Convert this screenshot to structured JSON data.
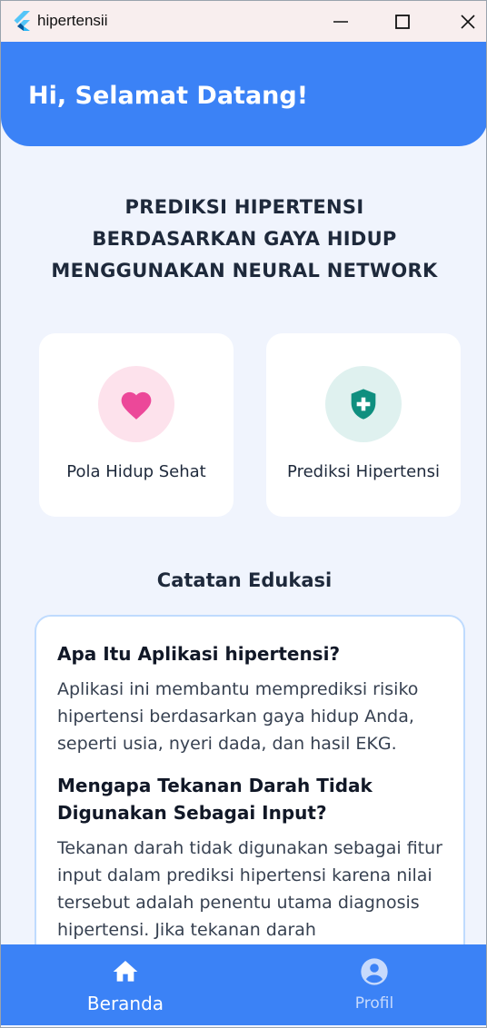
{
  "window": {
    "title": "hipertensii"
  },
  "header": {
    "greeting": "Hi, Selamat Datang!"
  },
  "main": {
    "title_lines": [
      "PREDIKSI HIPERTENSI",
      "BERDASARKAN GAYA HIDUP",
      "MENGGUNAKAN NEURAL NETWORK"
    ],
    "cards": [
      {
        "label": "Pola Hidup Sehat",
        "icon": "heart-icon",
        "icon_color": "#ec4899",
        "circle_color": "#fde2ec"
      },
      {
        "label": "Prediksi Hipertensi",
        "icon": "shield-plus-icon",
        "icon_color": "#0f8f7f",
        "circle_color": "#dff1ef"
      }
    ]
  },
  "education": {
    "title": "Catatan Edukasi",
    "items": [
      {
        "question": "Apa Itu Aplikasi hipertensi?",
        "answer": "Aplikasi ini membantu memprediksi risiko hipertensi berdasarkan gaya hidup Anda, seperti usia, nyeri dada, dan hasil EKG."
      },
      {
        "question": "Mengapa Tekanan Darah Tidak Digunakan Sebagai Input?",
        "answer": "Tekanan darah tidak digunakan sebagai fitur input dalam prediksi hipertensi karena nilai tersebut adalah penentu utama diagnosis hipertensi. Jika tekanan darah"
      }
    ]
  },
  "bottom_nav": {
    "items": [
      {
        "label": "Beranda",
        "icon": "home-icon",
        "active": true
      },
      {
        "label": "Profil",
        "icon": "account-circle-icon",
        "active": false
      }
    ]
  },
  "colors": {
    "primary": "#3b82f6",
    "background": "#f0f4fd",
    "text_dark": "#1e293b"
  }
}
